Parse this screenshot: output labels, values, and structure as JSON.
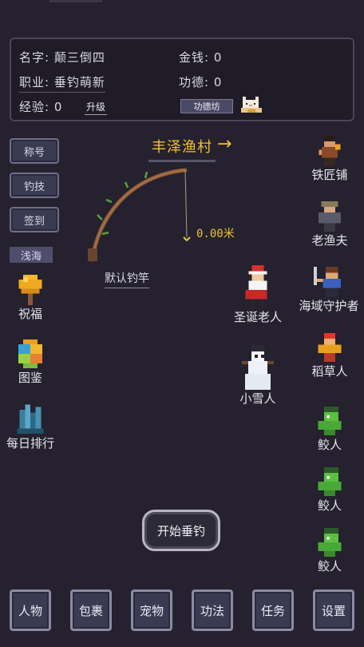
{
  "info": {
    "name_label": "名字:",
    "name_value": "颠三倒四",
    "money_label": "金钱:",
    "money_value": "0",
    "job_label": "职业:",
    "job_value": "垂钓萌新",
    "merit_label": "功德:",
    "merit_value": "0",
    "exp_label": "经验:",
    "exp_value": "0",
    "upgrade_label": "升级",
    "merit_shop_label": "功德坊"
  },
  "side_buttons": [
    "称号",
    "钓技",
    "签到"
  ],
  "area_label": "浅海",
  "village": {
    "title": "丰泽渔村",
    "arrow": "→"
  },
  "rod": {
    "distance": "0.00米",
    "name": "默认钓竿"
  },
  "left_items": [
    {
      "label": "祝福",
      "icon": "tree-icon"
    },
    {
      "label": "图鉴",
      "icon": "pie-icon"
    },
    {
      "label": "每日排行",
      "icon": "crystal-icon"
    }
  ],
  "right_npcs": [
    {
      "label": "铁匠铺",
      "icon": "blacksmith-icon"
    },
    {
      "label": "老渔夫",
      "icon": "old-fisher-icon"
    },
    {
      "label": "海域守护者",
      "icon": "guardian-icon"
    },
    {
      "label": "稻草人",
      "icon": "scarecrow-icon"
    },
    {
      "label": "鲛人",
      "icon": "merman-icon"
    },
    {
      "label": "鲛人",
      "icon": "merman-icon"
    },
    {
      "label": "鲛人",
      "icon": "merman-icon"
    }
  ],
  "center_npcs": [
    {
      "label": "圣诞老人",
      "icon": "santa-icon"
    },
    {
      "label": "小雪人",
      "icon": "snowman-icon"
    }
  ],
  "start_button": "开始垂钓",
  "nav": [
    "人物",
    "包裹",
    "宠物",
    "功法",
    "任务",
    "设置"
  ],
  "colors": {
    "background": "#25212e",
    "accent": "#f2c230",
    "button": "#3a3a52"
  }
}
